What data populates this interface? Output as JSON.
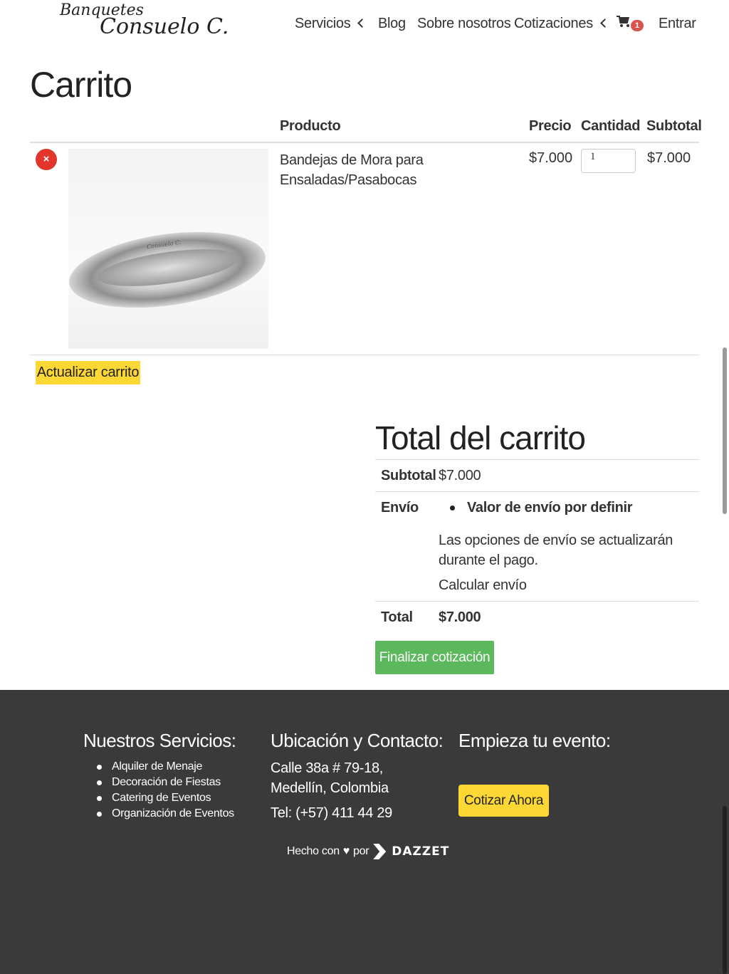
{
  "header": {
    "logo_line1": "Banquetes",
    "logo_line2": "Consuelo C.",
    "nav": {
      "servicios": "Servicios",
      "blog": "Blog",
      "sobre": "Sobre nosotros",
      "cotizaciones": "Cotizaciones",
      "cart_count": "1",
      "entrar": "Entrar"
    }
  },
  "page_title": "Carrito",
  "cart_table": {
    "headers": {
      "product": "Producto",
      "price": "Precio",
      "quantity": "Cantidad",
      "subtotal": "Subtotal"
    },
    "items": [
      {
        "remove_label": "×",
        "image_brand": "Consuelo C.",
        "name": "Bandejas de Mora para Ensaladas/Pasabocas",
        "price": "$7.000",
        "quantity": "1",
        "subtotal": "$7.000"
      }
    ],
    "update_button": "Actualizar carrito"
  },
  "totals": {
    "title": "Total del carrito",
    "subtotal_label": "Subtotal",
    "subtotal_value": "$7.000",
    "shipping_label": "Envío",
    "shipping_option": "Valor de envío por definir",
    "shipping_note": "Las opciones de envío se actualizarán durante el pago.",
    "calc_shipping": "Calcular envío",
    "total_label": "Total",
    "total_value": "$7.000",
    "checkout_button": "Finalizar cotización"
  },
  "footer": {
    "services_title": "Nuestros Servicios:",
    "services": [
      "Alquiler de Menaje",
      "Decoración de Fiestas",
      "Catering de Eventos",
      "Organización de Eventos"
    ],
    "contact_title": "Ubicación y Contacto:",
    "address": "Calle 38a # 79-18, Medellín, Colombia",
    "phone": "Tel: (+57) 411 44 29",
    "start_title": "Empieza tu evento:",
    "cta_button": "Cotizar Ahora",
    "credit_prefix": "Hecho con",
    "credit_heart": "♥",
    "credit_by": "por",
    "credit_brand": "DAZZET"
  },
  "colors": {
    "accent_yellow": "#fdd835",
    "checkout_green": "#5cb85c",
    "remove_red": "#e2352b",
    "badge_red": "#d9534f",
    "footer_bg": "#3a3a3a"
  }
}
